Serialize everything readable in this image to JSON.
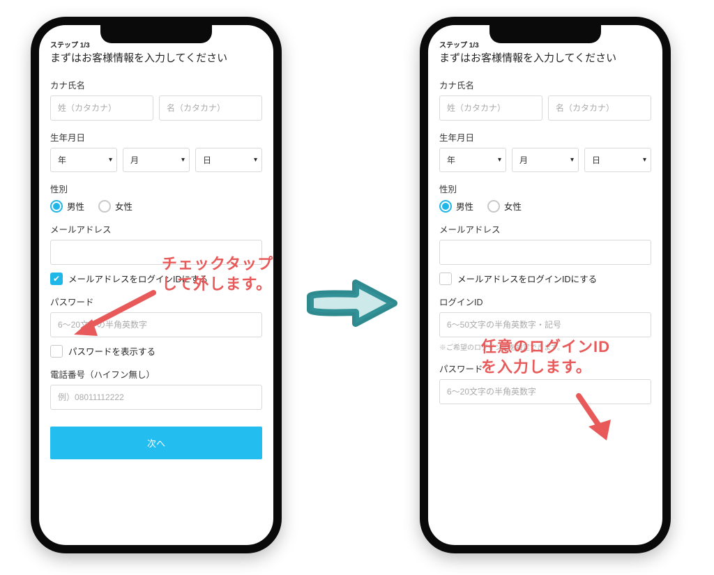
{
  "step_label": "ステップ 1/3",
  "headline": "まずはお客様情報を入力してください",
  "kana_label": "カナ氏名",
  "kana_last_ph": "姓（カタカナ）",
  "kana_first_ph": "名（カタカナ）",
  "dob_label": "生年月日",
  "year_label": "年",
  "month_label": "月",
  "day_label": "日",
  "gender_label": "性別",
  "male_label": "男性",
  "female_label": "女性",
  "email_label": "メールアドレス",
  "email_as_login_label": "メールアドレスをログインIDにする",
  "password_label": "パスワード",
  "password_ph": "6～20文字の半角英数字",
  "show_password_label": "パスワードを表示する",
  "phone_label": "電話番号（ハイフン無し）",
  "phone_ph": "例）08011112222",
  "next_btn": "次へ",
  "login_id_label": "ログインID",
  "login_id_ph": "6～50文字の半角英数字・記号",
  "login_id_hint": "※ご希望のログインIDを設定できます。",
  "anno1_line1": "チェックタップ",
  "anno1_line2": "して外します。",
  "anno2_line1": "任意のログインID",
  "anno2_line2": "を入力します。"
}
